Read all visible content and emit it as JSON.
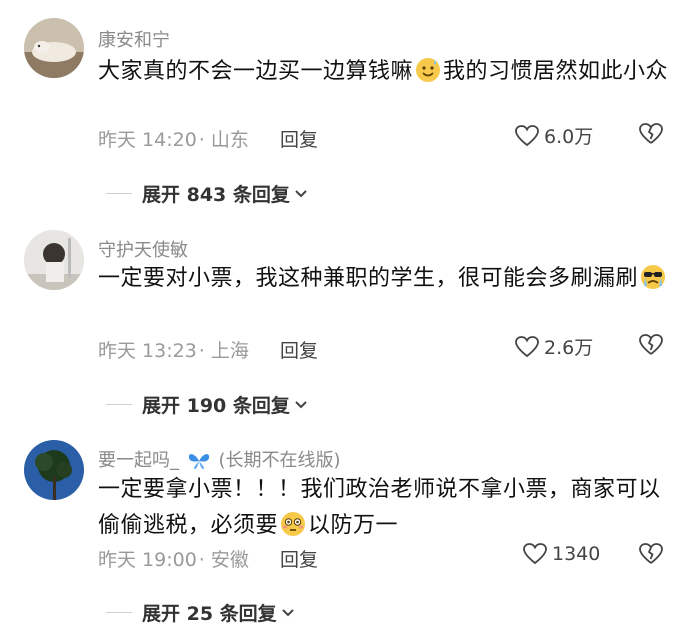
{
  "comments": [
    {
      "username": "康安和宁",
      "text_a": "大家真的不会一边买一边算钱嘛",
      "text_b": "我的习惯居然如此小众",
      "emoji": "sweat-smile-emoji",
      "time": "昨天 14:20",
      "location": "· 山东",
      "reply": "回复",
      "likes": "6.0万",
      "expand": "展开 843 条回复"
    },
    {
      "username": "守护天使敏",
      "text_a": "一定要对小票，我这种兼职的学生，很可能会多刷漏刷",
      "text_b": "",
      "emoji": "crying-sunglasses-emoji",
      "time": "昨天 13:23",
      "location": "· 上海",
      "reply": "回复",
      "likes": "2.6万",
      "expand": "展开 190 条回复"
    },
    {
      "username": "要一起吗_",
      "username_suffix": "(长期不在线版)",
      "badge": "butterfly-icon",
      "text_a": "一定要拿小票！！！我们政治老师说不拿小票，商家可以偷偷逃税，必须要",
      "text_b": "以防万一",
      "emoji": "flushed-emoji",
      "time": "昨天 19:00",
      "location": "· 安徽",
      "reply": "回复",
      "likes": "1340",
      "expand": "展开 25 条回复"
    }
  ],
  "colors": {
    "username": "#8a8a8a",
    "text": "#111111",
    "meta": "#9a9a9a",
    "action": "#444444",
    "emoji": "#f6c94a",
    "butterfly": "#3a8ee6"
  }
}
